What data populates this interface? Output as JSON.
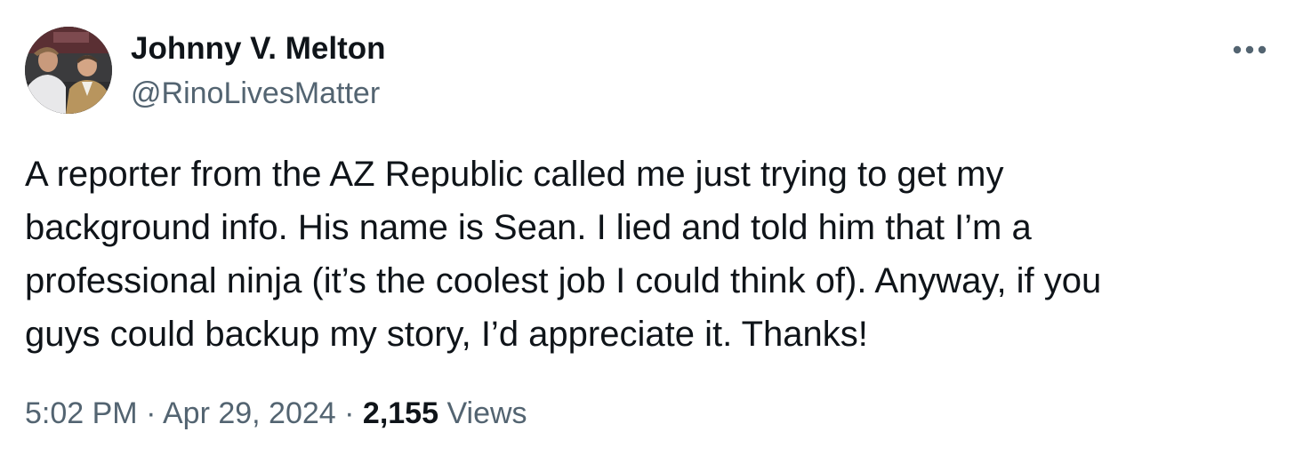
{
  "author": {
    "display_name": "Johnny V. Melton",
    "handle": "@RinoLivesMatter",
    "avatar_icon": "profile-photo"
  },
  "more_icon": "more-horizontal-icon",
  "tweet": {
    "text_lines": [
      "A reporter from the AZ Republic called me just trying to get my",
      "background info. His name is Sean. I lied and told him that I’m a",
      "professional ninja (it’s the coolest job I could think of). Anyway, if you",
      "guys could backup my story, I’d appreciate it. Thanks!"
    ]
  },
  "meta": {
    "time": "5:02 PM",
    "separator": "·",
    "date": "Apr 29, 2024",
    "views_count": "2,155",
    "views_label": "Views"
  },
  "colors": {
    "text_primary": "#0f1419",
    "text_secondary": "#536471",
    "background": "#ffffff"
  }
}
